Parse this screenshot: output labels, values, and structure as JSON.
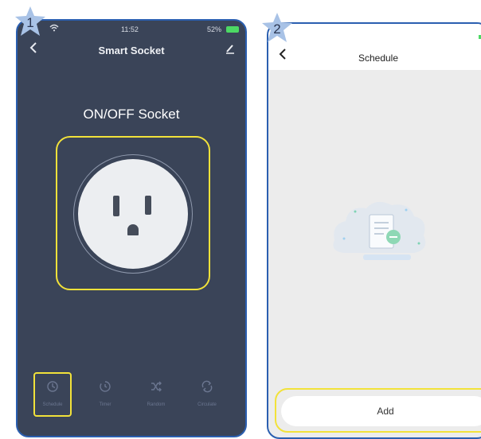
{
  "steps": [
    "1",
    "2"
  ],
  "phone1": {
    "status": {
      "time": "11:52",
      "battery": "52%"
    },
    "nav": {
      "title": "Smart Socket",
      "back_icon": "chevron-left-icon",
      "edit_icon": "pencil-icon"
    },
    "heading": "ON/OFF Socket",
    "tabs": [
      {
        "label": "Schedule",
        "icon": "clock-icon"
      },
      {
        "label": "Timer",
        "icon": "timer-icon"
      },
      {
        "label": "Random",
        "icon": "shuffle-icon"
      },
      {
        "label": "Circulate",
        "icon": "circulate-icon"
      }
    ]
  },
  "phone2": {
    "nav": {
      "title": "Schedule",
      "back_icon": "chevron-left-icon"
    },
    "add_label": "Add"
  },
  "colors": {
    "dark_bg": "#3a4458",
    "highlight": "#f2e23a",
    "frame": "#2b5fb0",
    "light_bg": "#ececec"
  }
}
